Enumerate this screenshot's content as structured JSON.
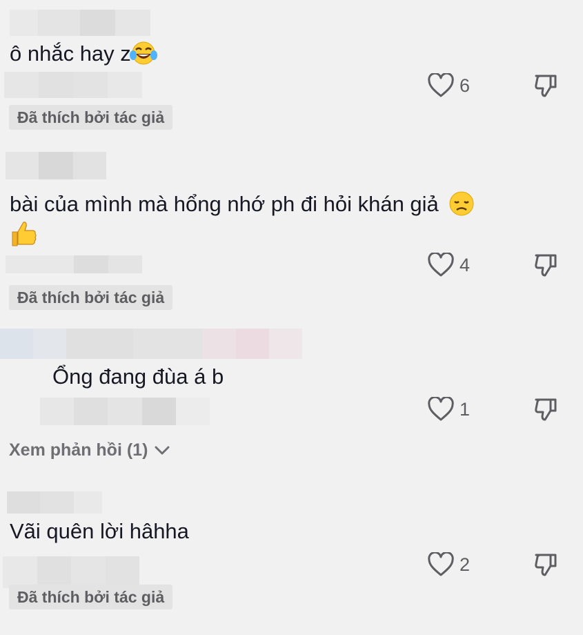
{
  "comments": [
    {
      "text": "ô nhắc hay z",
      "emoji": "laughing-tears-emoji",
      "likes": "6",
      "badge": "Đã thích bởi tác giả"
    },
    {
      "text": "bài của mình mà hổng nhớ ph đi hỏi khán giả",
      "emoji": "disappointed-face-emoji",
      "emoji2": "thumbs-up-emoji",
      "likes": "4",
      "badge": "Đã thích bởi tác giả"
    },
    {
      "text": "Ổng đang đùa á b",
      "likes": "1",
      "replies_label": "Xem phản hồi (1)"
    },
    {
      "text": "Vãi quên lời hâhha",
      "likes": "2",
      "badge": "Đã thích bởi tác giả"
    }
  ],
  "colors": {
    "background": "#f1f1f1",
    "text": "#161823",
    "muted": "#5e5e62",
    "badge_bg": "#e3e3e3",
    "emoji_yellow": "#ffcc33"
  }
}
